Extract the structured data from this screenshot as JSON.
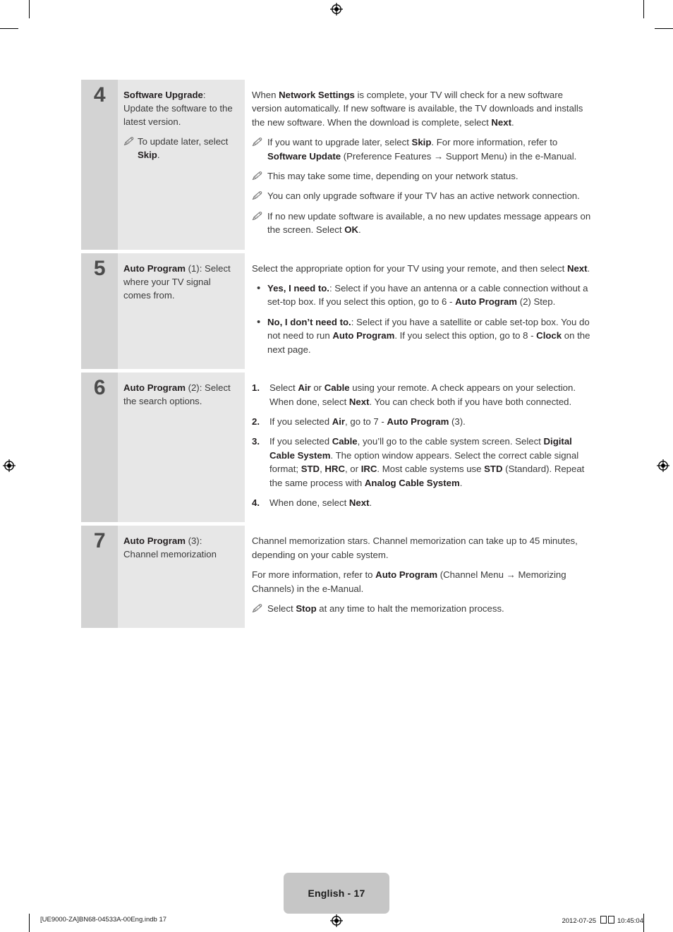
{
  "footer": {
    "page_badge": "English - 17",
    "file_info": "[UE9000-ZA]BN68-04533A-00Eng.indb   17",
    "date": "2012-07-25",
    "time": "10:45:04"
  },
  "colors": {
    "number_cell_bg": "#d3d3d3",
    "desc_cell_bg": "#e7e7e7",
    "badge_bg": "#c6c6c6",
    "text": "#3a3a3a",
    "bold_text": "#231f20"
  },
  "steps": [
    {
      "number": "4",
      "desc_title_bold": "Software Upgrade",
      "desc_title_rest": ":",
      "desc_body": "Update the software to the latest version.",
      "desc_note": {
        "pre": "To update later, select ",
        "bold": "Skip",
        "post": "."
      },
      "detail": {
        "intro_p1": "When ",
        "intro_b1": "Network Settings",
        "intro_p2": " is complete, your TV will check for a new software version automatically. If new software is available, the TV downloads and installs the new software. When the download is complete, select ",
        "intro_b2": "Next",
        "intro_p3": ".",
        "notes": [
          {
            "p1": "If you want to upgrade later, select ",
            "b1": "Skip",
            "p2": ". For more information, refer to ",
            "b2": "Software Update",
            "p3": " (Preference Features → Support Menu) in the e-Manual."
          },
          {
            "p1": "This may take some time, depending on your network status.",
            "b1": "",
            "p2": "",
            "b2": "",
            "p3": ""
          },
          {
            "p1": "You can only upgrade software if your TV has an active network connection.",
            "b1": "",
            "p2": "",
            "b2": "",
            "p3": ""
          },
          {
            "p1": "If no new update software is available, a no new updates message appears on the screen. Select ",
            "b1": "OK",
            "p2": ".",
            "b2": "",
            "p3": ""
          }
        ]
      }
    },
    {
      "number": "5",
      "desc_title_bold": "Auto Program",
      "desc_title_rest": " (1):",
      "desc_body": "Select where your TV signal comes from.",
      "detail": {
        "intro_p1": "Select the appropriate option for your TV using your remote, and then select ",
        "intro_b1": "Next",
        "intro_p2": ".",
        "intro_b2": "",
        "intro_p3": "",
        "bullets": [
          {
            "b1": "Yes, I need to.",
            "p1": ": Select if you have an antenna or a cable connection without a set-top box. If you select this option, go to 6 - ",
            "b2": "Auto Program",
            "p2": " (2) Step."
          },
          {
            "b1": "No, I don’t need to.",
            "p1": ": Select if you have a satellite or cable set-top box. You do not need to run ",
            "b2": "Auto Program",
            "p2": ". If you select this option, go to 8 - ",
            "b3": "Clock",
            "p3": " on the next page."
          }
        ]
      }
    },
    {
      "number": "6",
      "desc_title_bold": "Auto Program",
      "desc_title_rest": " (2):",
      "desc_body": "Select the search options.",
      "detail": {
        "numbered": [
          {
            "marker": "1.",
            "p1": "Select ",
            "b1": "Air",
            "p2": " or ",
            "b2": "Cable",
            "p3": " using your remote. A check appears on your selection. When done, select ",
            "b3": "Next",
            "p4": ". You can check both if you have both connected."
          },
          {
            "marker": "2.",
            "p1": "If you selected ",
            "b1": "Air",
            "p2": ", go to 7 - ",
            "b2": "Auto Program",
            "p3": " (3).",
            "b3": "",
            "p4": ""
          },
          {
            "marker": "3.",
            "p1": "If you selected ",
            "b1": "Cable",
            "p2": ", you’ll go to the cable system screen. Select ",
            "b2": "Digital Cable System",
            "p3": ". The option window appears. Select the correct cable signal format; ",
            "b3": "STD",
            "p4": ", ",
            "b4": "HRC",
            "p5": ", or ",
            "b5": "IRC",
            "p6": ". Most cable systems use ",
            "b6": "STD",
            "p7": " (Standard). Repeat the same process with ",
            "b7": "Analog Cable System",
            "p8": "."
          },
          {
            "marker": "4.",
            "p1": "When done, select ",
            "b1": "Next",
            "p2": ".",
            "b2": "",
            "p3": "",
            "b3": "",
            "p4": ""
          }
        ]
      }
    },
    {
      "number": "7",
      "desc_title_bold": "Auto Program",
      "desc_title_rest": " (3):",
      "desc_body": "Channel memorization",
      "detail": {
        "para1": "Channel memorization stars. Channel memorization can take up to 45 minutes, depending on your cable system.",
        "para2_p1": "For more information, refer to ",
        "para2_b1": "Auto Program",
        "para2_p2": " (Channel Menu → Memorizing Channels) in the e-Manual.",
        "note_p1": "Select ",
        "note_b1": "Stop",
        "note_p2": " at any time to halt the memorization process."
      }
    }
  ]
}
